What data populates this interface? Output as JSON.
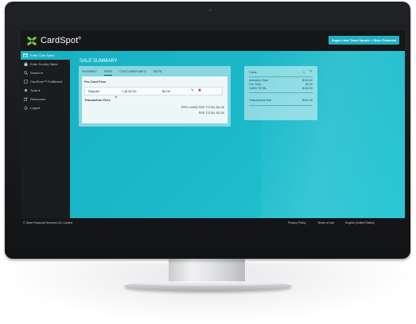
{
  "app": {
    "logo_text": "CardSpot",
    "logo_mark": "®",
    "store_button": "Sugar Land Town Square > Store Financial"
  },
  "sidebar": {
    "items": [
      {
        "label": "Enter Card Sales",
        "icon": "card-icon",
        "active": true
      },
      {
        "label": "Enter Sundry Sales",
        "icon": "bag-icon",
        "active": false
      },
      {
        "label": "Search ▾",
        "icon": "search-icon",
        "active": false
      },
      {
        "label": "CardFree™ Fulfillment",
        "icon": "doc-icon",
        "active": false
      },
      {
        "label": "Tools ▾",
        "icon": "gear-icon",
        "active": false
      },
      {
        "label": "Resources",
        "icon": "external-link-icon",
        "active": false
      },
      {
        "label": "Logout",
        "icon": "power-icon",
        "active": false
      }
    ]
  },
  "sale_summary": {
    "title": "SALE SUMMARY",
    "tabs": [
      "PAYMENT",
      "FEES",
      "CUSTOMER INFO",
      "NOTE"
    ],
    "active_tab": "FEES",
    "per_card_fees_label": "Per-Card Fees",
    "fee_row": {
      "name": "Regular",
      "qty_price": "1 @ $2.00",
      "amount": "$2.00"
    },
    "transaction_fees_label": "Transaction Fees",
    "per_card_fee_total": "PER-CARD FEE TOTAL $2.00",
    "fee_total": "FEE TOTAL $2.00"
  },
  "cards_panel": {
    "title": "Cards",
    "count": "1",
    "activation_total_label": "Activation Total",
    "activation_total_value": "$100.00",
    "fee_total_label": "Fee Total",
    "fee_total_value": "$2.00",
    "card_total_label": "CARD TOTAL",
    "card_total_value": "$102.00",
    "amount_due_label": "Total Amount Due",
    "amount_due_value": "$102.00"
  },
  "footer": {
    "copyright": "© Store Financial Services US, Limited",
    "links": [
      "Privacy Policy",
      "Terms of Use",
      "English (United States)"
    ]
  },
  "colors": {
    "accent": "#1ab0c3",
    "brand_green": "#7ac142",
    "delete_red": "#c0272d",
    "edit_blue": "#1b86a8"
  }
}
